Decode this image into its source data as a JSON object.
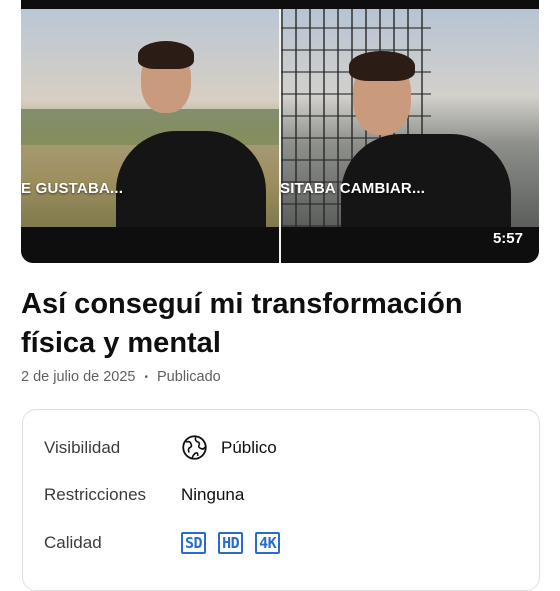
{
  "video": {
    "thumbnail_captions": [
      "E GUSTABA...",
      "SITABA CAMBIAR..."
    ],
    "duration": "5:57",
    "title": "Así conseguí mi transformación física y mental",
    "date": "2 de julio de 2025",
    "separator": "•",
    "status": "Publicado"
  },
  "details": {
    "visibility": {
      "label": "Visibilidad",
      "value": "Público",
      "icon": "globe-icon"
    },
    "restrictions": {
      "label": "Restricciones",
      "value": "Ninguna"
    },
    "quality": {
      "label": "Calidad",
      "badges": [
        "SD",
        "HD",
        "4K"
      ],
      "badge_color": "#2a6cc9"
    }
  }
}
